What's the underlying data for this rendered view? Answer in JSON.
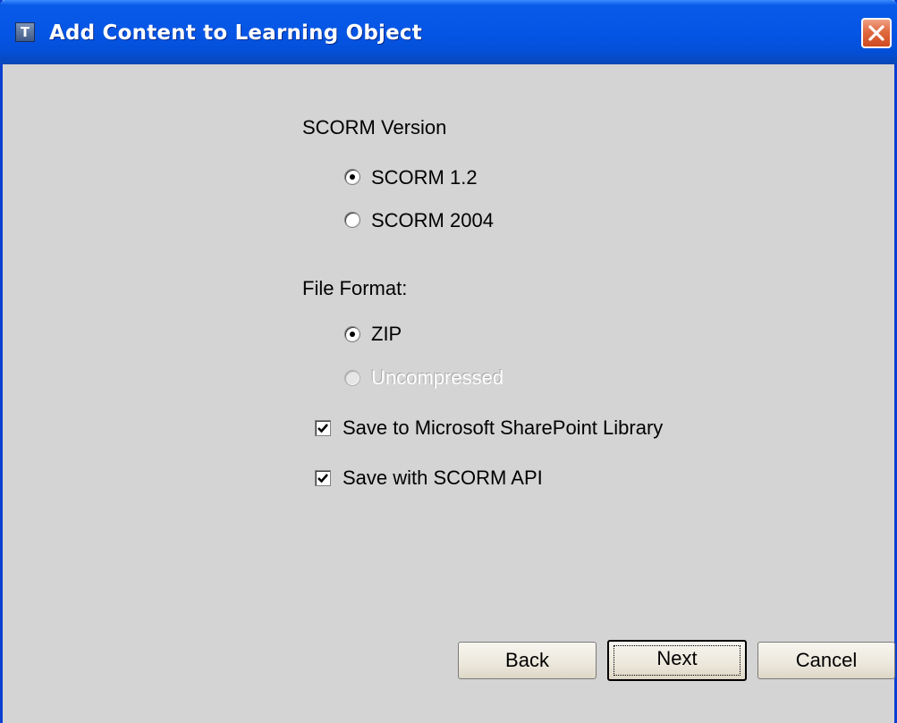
{
  "window": {
    "title": "Add Content to Learning Object",
    "app_icon_glyph": "T",
    "app_icon": "app-icon",
    "close_icon": "close-icon",
    "accent_color": "#0556e6",
    "close_color": "#e06a3f"
  },
  "scorm_version": {
    "heading": "SCORM Version",
    "options": [
      {
        "label": "SCORM 1.2",
        "checked": true,
        "enabled": true
      },
      {
        "label": "SCORM 2004",
        "checked": false,
        "enabled": true
      }
    ]
  },
  "file_format": {
    "heading": "File Format:",
    "options": [
      {
        "label": "ZIP",
        "checked": true,
        "enabled": true
      },
      {
        "label": "Uncompressed",
        "checked": false,
        "enabled": false
      }
    ]
  },
  "options": {
    "save_sharepoint": {
      "label": "Save to Microsoft SharePoint Library",
      "checked": true
    },
    "save_scorm_api": {
      "label": "Save with SCORM API",
      "checked": true
    }
  },
  "buttons": {
    "back": "Back",
    "next": "Next",
    "cancel": "Cancel"
  }
}
